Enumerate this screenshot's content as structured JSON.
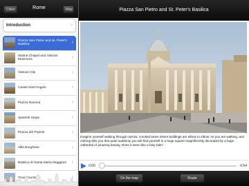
{
  "sidebar": {
    "cities_button": "Cities",
    "map_button": "Map",
    "title": "Rome",
    "intro_label": "Introduction",
    "items": [
      {
        "label": "Piazza San Pietro and St. Peter's Basilica",
        "selected": true
      },
      {
        "label": "Sistine Chapel and Vatican Museums",
        "selected": false
      },
      {
        "label": "Vatican City",
        "selected": false
      },
      {
        "label": "Castel Sant'Angelo",
        "selected": false
      },
      {
        "label": "Piazza Navona",
        "selected": false
      },
      {
        "label": "Spanish Steps",
        "selected": false
      },
      {
        "label": "Piazza del Popolo",
        "selected": false
      },
      {
        "label": "Villa Borghese",
        "selected": false
      },
      {
        "label": "Basilica di Santa Maria Maggiore",
        "selected": false
      },
      {
        "label": "Trevi Fountain",
        "selected": false
      }
    ],
    "chevron": "›"
  },
  "main": {
    "title": "Piazza San Pietro and St. Peter's Basilica",
    "description": "Imagine yourself walking through narrow, crooked lanes where buildings are elbow to elbow. As you are walking, and nothing tells you that quite suddenly you will find yourself in a huge square magnificently decorated by a huge cathedral of amazing beauty. Does it seem like a fairy tale?",
    "photo_icon": "st-peters-basilica-photo"
  },
  "player": {
    "current_time": "0:00",
    "duration": "6:54",
    "progress": 0,
    "play_icon": "play-icon"
  },
  "bottom": {
    "on_the_map": "On the map",
    "route": "Route"
  },
  "colors": {
    "selected_row": "#3a6bd6",
    "play_blue": "#2f6fdc",
    "bar_dark": "#141414"
  }
}
